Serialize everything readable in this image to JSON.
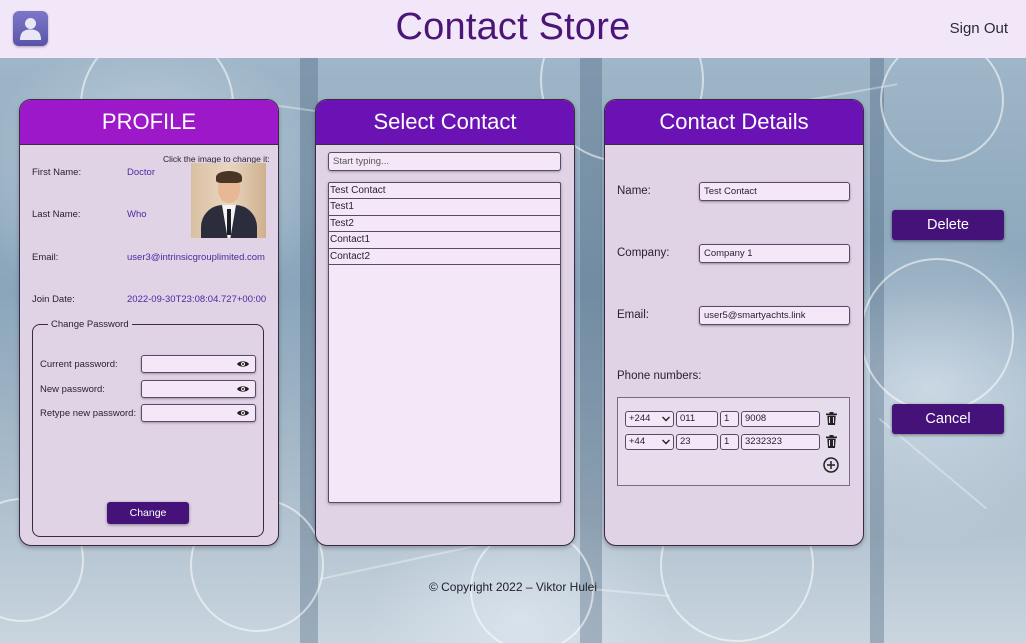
{
  "header": {
    "title": "Contact Store",
    "signout_label": "Sign Out",
    "avatar_icon": "user-icon"
  },
  "profile": {
    "title": "PROFILE",
    "image_hint": "Click the image to change it:",
    "first_name_label": "First Name:",
    "first_name_value": "Doctor",
    "last_name_label": "Last Name:",
    "last_name_value": "Who",
    "email_label": "Email:",
    "email_value": "user3@intrinsicgrouplimited.com",
    "join_date_label": "Join Date:",
    "join_date_value": "2022-09-30T23:08:04.727+00:00",
    "change_password": {
      "legend": "Change Password",
      "current_label": "Current password:",
      "new_label": "New password:",
      "retype_label": "Retype new password:",
      "button_label": "Change",
      "eye_icon": "eye-icon"
    }
  },
  "select_contact": {
    "title": "Select Contact",
    "search_placeholder": "Start typing...",
    "contacts": [
      "Test Contact",
      "Test1",
      "Test2",
      "Contact1",
      "Contact2"
    ]
  },
  "contact_details": {
    "title": "Contact Details",
    "name_label": "Name:",
    "name_value": "Test Contact",
    "company_label": "Company:",
    "company_value": "Company 1",
    "email_label": "Email:",
    "email_value": "user5@smartyachts.link",
    "phones_label": "Phone numbers:",
    "phones": [
      {
        "country_code": "+244",
        "area_code": "011",
        "prefix": "1",
        "number": "9008"
      },
      {
        "country_code": "+44",
        "area_code": "23",
        "prefix": "1",
        "number": "3232323"
      }
    ]
  },
  "actions": {
    "delete_label": "Delete",
    "cancel_label": "Cancel"
  },
  "footer": {
    "text": "© Copyright 2022 – Viktor Hulei"
  },
  "colors": {
    "header_bg": "#f2e6f9",
    "profile_head": "#9c18c8",
    "panel_head": "#6b12b5",
    "button": "#45127a",
    "title": "#4b1677"
  }
}
